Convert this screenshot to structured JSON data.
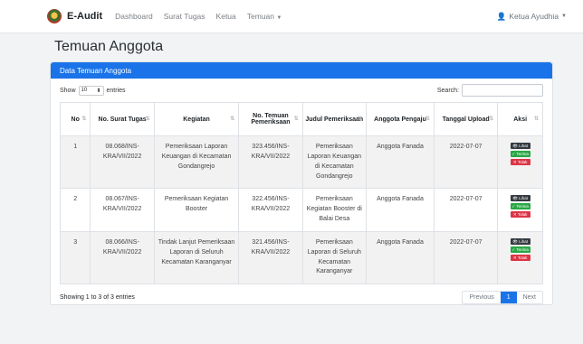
{
  "app": {
    "brand": "E-Audit"
  },
  "nav": {
    "items": [
      "Dashboard",
      "Surat Tugas",
      "Ketua",
      "Temuan"
    ],
    "user": "Ketua Ayudhia"
  },
  "page": {
    "title": "Temuan Anggota"
  },
  "card": {
    "header": "Data Temuan Anggota"
  },
  "controls": {
    "show_label": "Show",
    "entries_value": "10",
    "entries_label": "entries",
    "search_label": "Search:"
  },
  "table": {
    "headers": [
      "No",
      "No. Surat Tugas",
      "Kegiatan",
      "No. Temuan Pemeriksaan",
      "Judul Pemeriksaan",
      "Anggota Pengaju",
      "Tanggal Upload",
      "Aksi"
    ],
    "rows": [
      {
        "no": "1",
        "surat": "08.068/INS-KRA/VII/2022",
        "kegiatan": "Pemeriksaan Laporan Keuangan di Kecamatan Gondangrejo",
        "temuan": "323.456/INS-KRA/VII/2022",
        "judul": "Pemeriksaan Laporan Keuangan di Kecamatan Gondangrejo",
        "anggota": "Anggota Fanada",
        "tanggal": "2022-07-07"
      },
      {
        "no": "2",
        "surat": "08.067/INS-KRA/VII/2022",
        "kegiatan": "Pemeriksaan Kegiatan Booster",
        "temuan": "322.456/INS-KRA/VII/2022",
        "judul": "Pemeriksaan Kegiatan Booster di Balai Desa",
        "anggota": "Anggota Fanada",
        "tanggal": "2022-07-07"
      },
      {
        "no": "3",
        "surat": "08.066/INS-KRA/VII/2022",
        "kegiatan": "Tindak Lanjut Pemeriksaan Laporan di Seluruh Kecamatan Karanganyar",
        "temuan": "321.456/INS-KRA/VII/2022",
        "judul": "Pemeriksaan Laporan di Seluruh Kecamatan Karanganyar",
        "anggota": "Anggota Fanada",
        "tanggal": "2022-07-07"
      }
    ],
    "actions": {
      "view": "Lihat",
      "accept": "Terima",
      "reject": "Tolak"
    }
  },
  "footer": {
    "info": "Showing 1 to 3 of 3 entries",
    "prev": "Previous",
    "page": "1",
    "next": "Next"
  }
}
